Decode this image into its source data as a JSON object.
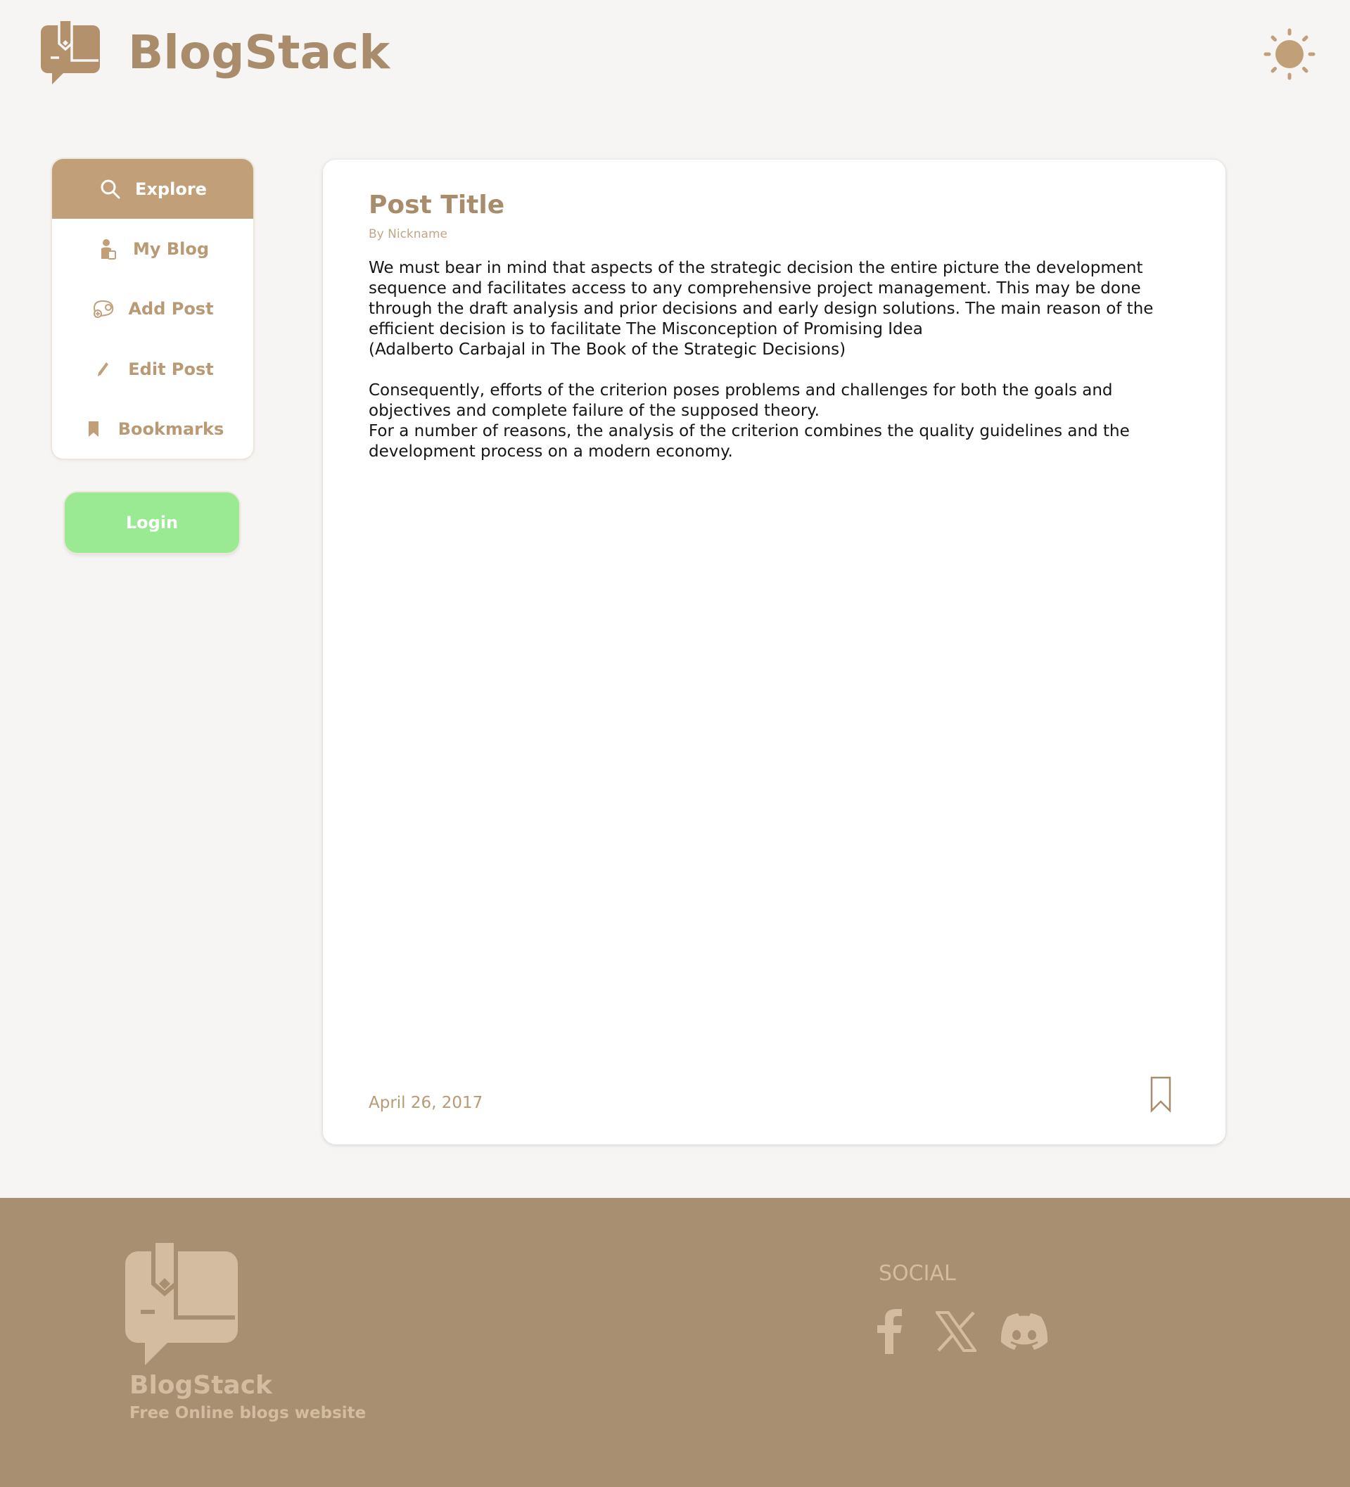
{
  "app": {
    "brand": "BlogStack"
  },
  "header": {
    "logo_icon": "book-chat-pen-logo-icon",
    "theme_toggle_icon": "sun-icon"
  },
  "sidebar": {
    "items": [
      {
        "label": "Explore",
        "icon": "search-icon",
        "active": true
      },
      {
        "label": "My Blog",
        "icon": "user-icon",
        "active": false
      },
      {
        "label": "Add Post",
        "icon": "add-post-icon",
        "active": false
      },
      {
        "label": "Edit Post",
        "icon": "pencil-icon",
        "active": false
      },
      {
        "label": "Bookmarks",
        "icon": "bookmark-icon",
        "active": false
      }
    ],
    "login_label": "Login"
  },
  "post": {
    "title": "Post Title",
    "author": "By Nickname",
    "paragraphs": [
      "We must bear in mind that aspects of the strategic decision the entire picture the development sequence and facilitates access to any comprehensive project management. This may be done through the draft analysis and prior decisions and early design solutions. The main reason of the efficient decision is to facilitate The Misconception of Promising Idea",
      "(Adalberto Carbajal in The Book of the Strategic Decisions)",
      "Consequently, efforts of the criterion poses problems and challenges for both the goals and objectives and complete failure of the supposed theory.",
      "For a number of reasons, the analysis of the criterion combines the quality guidelines and the development process  on a modern economy."
    ],
    "date": "April 26, 2017",
    "bookmark_icon": "bookmark-outline-icon"
  },
  "footer": {
    "brand": "BlogStack",
    "tagline": "Free Online blogs website",
    "social_title": "SOCIAL",
    "social_icons": [
      "facebook-icon",
      "x-icon",
      "discord-icon"
    ]
  },
  "colors": {
    "brand": "#a88c6c",
    "active_nav": "#c1a079",
    "login_button": "#99ea92",
    "footer_bg": "#a98f71",
    "footer_text": "#d3bca0",
    "page_bg": "#f7f5f3"
  }
}
